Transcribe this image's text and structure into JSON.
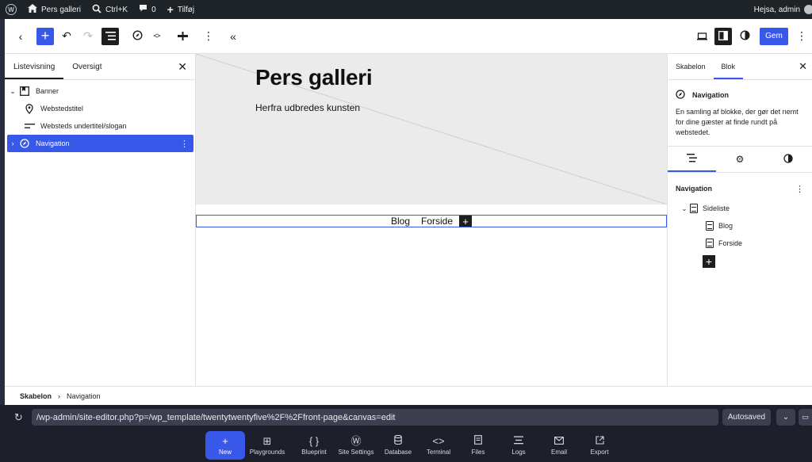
{
  "adminbar": {
    "site_name": "Pers galleri",
    "search_shortcut": "Ctrl+K",
    "comments_count": "0",
    "add_label": "Tilføj",
    "greeting": "Hejsa, admin"
  },
  "toolbar": {
    "save_label": "Gem"
  },
  "left_panel": {
    "tabs": [
      "Listevisning",
      "Oversigt"
    ],
    "tree": [
      {
        "label": "Banner",
        "icon": "bookmark-icon"
      },
      {
        "label": "Webstedstitel",
        "icon": "location-pin-icon"
      },
      {
        "label": "Websteds undertitel/slogan",
        "icon": "text-lines-icon"
      },
      {
        "label": "Navigation",
        "icon": "compass-icon"
      }
    ]
  },
  "canvas": {
    "site_title": "Pers galleri",
    "tagline": "Herfra udbredes kunsten",
    "nav_links": [
      "Blog",
      "Forside"
    ]
  },
  "right_panel": {
    "tabs": [
      "Skabelon",
      "Blok"
    ],
    "block_name": "Navigation",
    "block_description": "En samling af blokke, der gør det nemt for dine gæster at finde rundt på webstedet.",
    "nav_title": "Navigation",
    "items": {
      "parent": "Sideliste",
      "children": [
        "Blog",
        "Forside"
      ]
    }
  },
  "breadcrumb": [
    "Skabelon",
    "Navigation"
  ],
  "playground": {
    "url": "/wp-admin/site-editor.php?p=/wp_template/twentytwentyfive%2F%2Ffront-page&canvas=edit",
    "status": "Autosaved",
    "dock": [
      {
        "label": "New",
        "icon": "plus-icon"
      },
      {
        "label": "Playgrounds",
        "icon": "grid-icon"
      },
      {
        "label": "Blueprint",
        "icon": "braces-icon"
      },
      {
        "label": "Site Settings",
        "icon": "wordpress-icon"
      },
      {
        "label": "Database",
        "icon": "database-icon"
      },
      {
        "label": "Terminal",
        "icon": "code-icon"
      },
      {
        "label": "Files",
        "icon": "file-icon"
      },
      {
        "label": "Logs",
        "icon": "logs-icon"
      },
      {
        "label": "Email",
        "icon": "envelope-icon"
      },
      {
        "label": "Export",
        "icon": "export-icon"
      }
    ]
  }
}
